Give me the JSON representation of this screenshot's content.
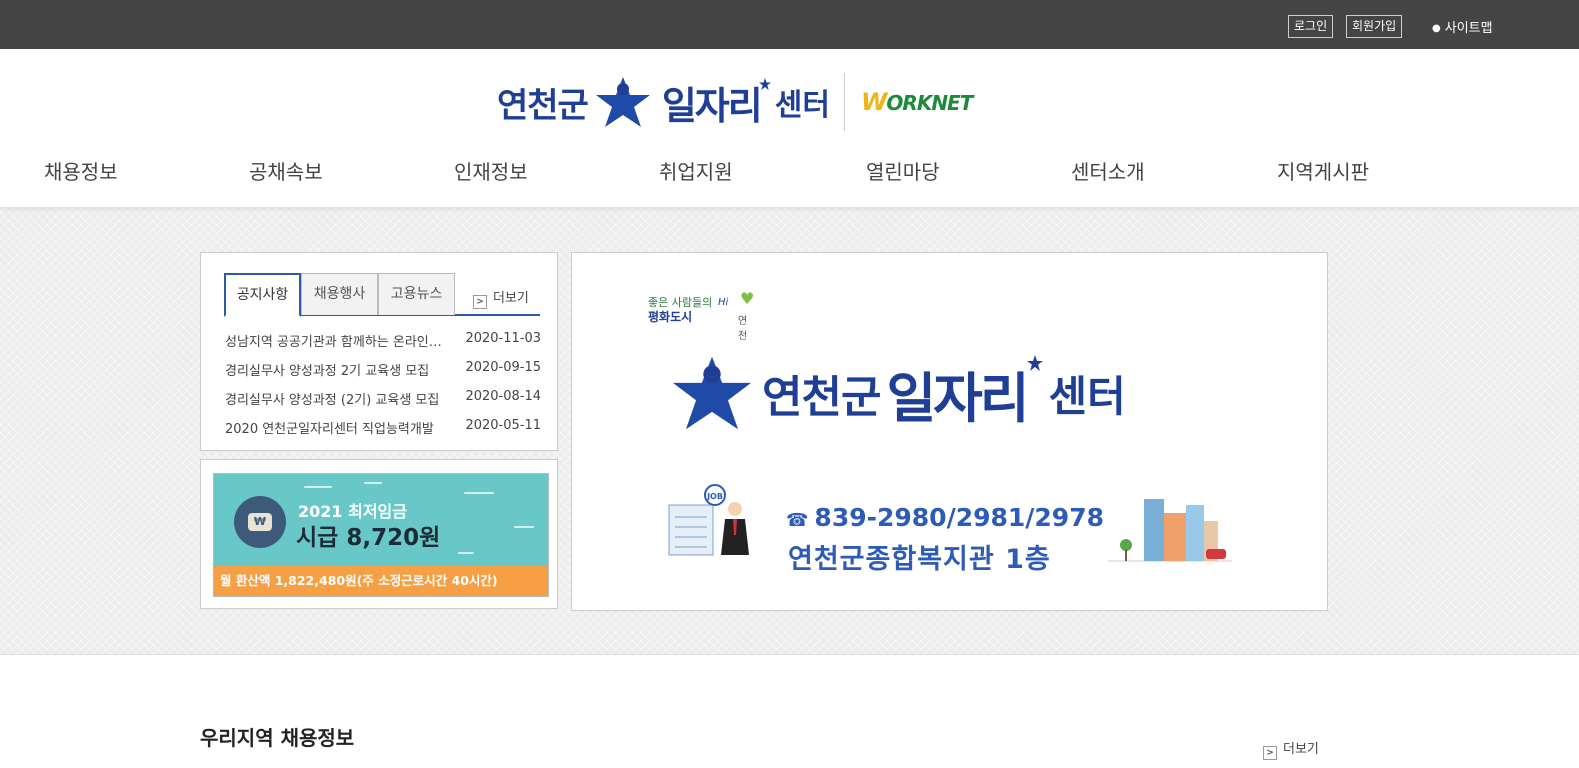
{
  "topbar": {
    "login": "로그인",
    "join": "회원가입",
    "sitemap": "사이트맵"
  },
  "header": {
    "logo_part1": "연천군",
    "logo_part2": "일자리",
    "logo_part3": "센터",
    "worknet_w": "W",
    "worknet_rest": "ORKNET"
  },
  "nav": [
    {
      "label": "채용정보"
    },
    {
      "label": "공채속보"
    },
    {
      "label": "인재정보"
    },
    {
      "label": "취업지원"
    },
    {
      "label": "열린마당"
    },
    {
      "label": "센터소개"
    },
    {
      "label": "지역게시판"
    }
  ],
  "notice": {
    "tabs": [
      "공지사항",
      "채용행사",
      "고용뉴스"
    ],
    "more": "더보기",
    "items": [
      {
        "title": "성남지역 공공기관과 함께하는 온라인 채용",
        "date": "2020-11-03"
      },
      {
        "title": "경리실무사 양성과정 2기 교육생 모집",
        "date": "2020-09-15"
      },
      {
        "title": "경리실무사 양성과정 (2기) 교육생 모집",
        "date": "2020-08-14"
      },
      {
        "title": "2020 연천군일자리센터 직업능력개발",
        "date": "2020-05-11"
      }
    ]
  },
  "wage": {
    "line1": "2021 최저임금",
    "line2": "시급 8,720원",
    "coin": "₩",
    "bottom": "월 환산액 1,822,480원(주 소정근로시간 40시간)"
  },
  "banner": {
    "slogan_line1": "좋은 사람들의",
    "slogan_line2": "평화도시",
    "slogan_hi": "Hi",
    "slogan_city": "연천",
    "logo_part1": "연천군",
    "logo_part2": "일자리",
    "logo_part3": "센터",
    "phone": "839-2980/2981/2978",
    "address": "연천군종합복지관 1층",
    "job_badge": "JOB"
  },
  "section": {
    "title": "우리지역 채용정보",
    "more": "더보기"
  },
  "colors": {
    "topbar": "#444444",
    "brand_blue": "#1f3e96",
    "tab_accent": "#2a5aa8",
    "wage_bg": "#68c8c8",
    "wage_bottom": "#f6a046"
  }
}
